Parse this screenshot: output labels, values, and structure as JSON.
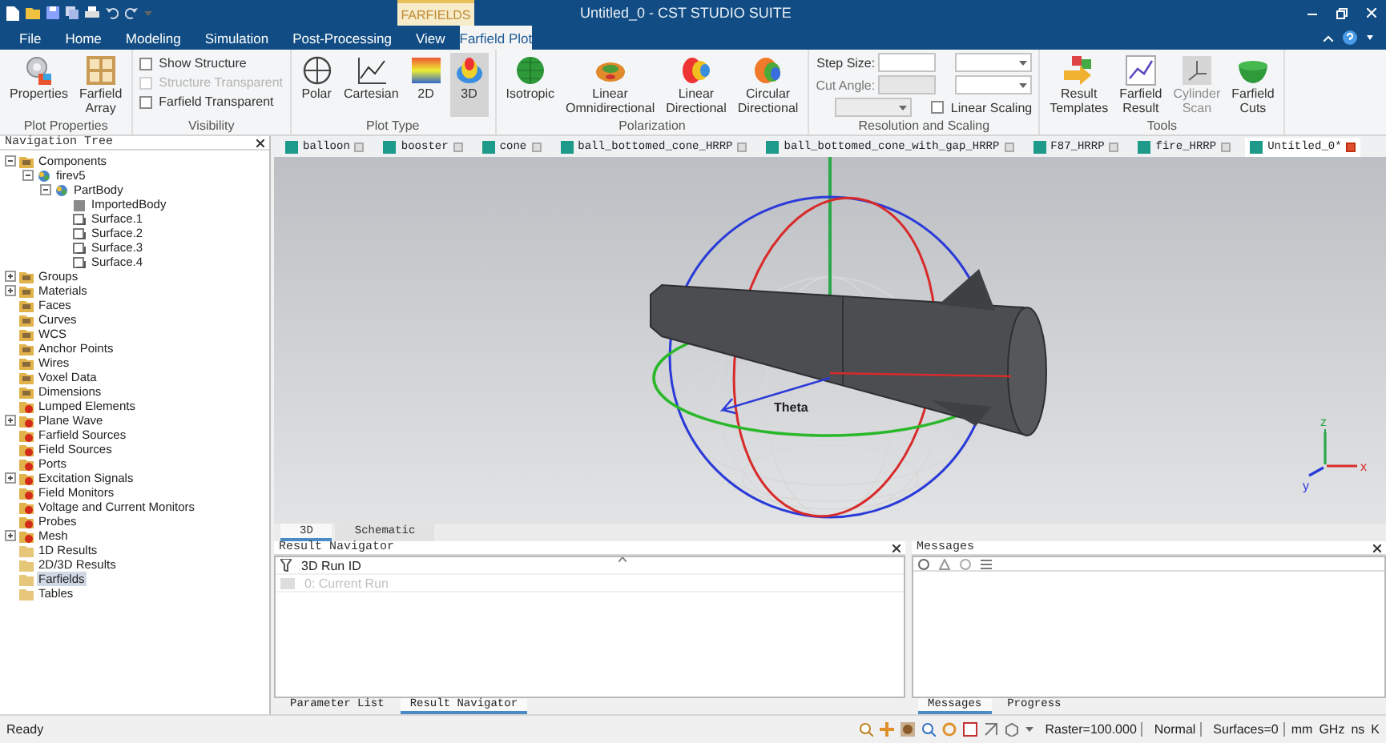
{
  "window": {
    "title": "Untitled_0 - CST STUDIO SUITE",
    "context_tab": "FARFIELDS"
  },
  "menu_tabs": [
    {
      "label": "File",
      "selected": false
    },
    {
      "label": "Home",
      "selected": false
    },
    {
      "label": "Modeling",
      "selected": false
    },
    {
      "label": "Simulation",
      "selected": false
    },
    {
      "label": "Post-Processing",
      "selected": false
    },
    {
      "label": "View",
      "selected": false
    },
    {
      "label": "Farfield Plot",
      "selected": true
    }
  ],
  "ribbon": {
    "groups": [
      {
        "title": "Plot Properties",
        "kind": "buttons",
        "items": [
          {
            "label": "Properties",
            "selected": false,
            "disabled": false
          },
          {
            "label": "Farfield\nArray",
            "selected": false,
            "disabled": false
          }
        ]
      },
      {
        "title": "Visibility",
        "kind": "checks",
        "items": [
          {
            "label": "Show Structure",
            "checked": false,
            "disabled": false
          },
          {
            "label": "Structure Transparent",
            "checked": false,
            "disabled": true
          },
          {
            "label": "Farfield Transparent",
            "checked": false,
            "disabled": false
          }
        ]
      },
      {
        "title": "Plot Type",
        "kind": "buttons",
        "items": [
          {
            "label": "Polar",
            "selected": false,
            "disabled": false
          },
          {
            "label": "Cartesian",
            "selected": false,
            "disabled": false
          },
          {
            "label": "2D",
            "selected": false,
            "disabled": false
          },
          {
            "label": "3D",
            "selected": true,
            "disabled": false
          }
        ]
      },
      {
        "title": "Polarization",
        "kind": "buttons",
        "items": [
          {
            "label": "Isotropic",
            "selected": false,
            "disabled": false
          },
          {
            "label": "Linear\nOmnidirectional",
            "selected": false,
            "disabled": false
          },
          {
            "label": "Linear\nDirectional",
            "selected": false,
            "disabled": false
          },
          {
            "label": "Circular\nDirectional",
            "selected": false,
            "disabled": false
          }
        ]
      },
      {
        "title": "Resolution and Scaling",
        "kind": "form",
        "rows": [
          [
            {
              "kind": "field",
              "label": "Step Size:",
              "disabled": false
            },
            {
              "kind": "dropdown",
              "disabled": false
            }
          ],
          [
            {
              "kind": "field",
              "label": "Cut Angle:",
              "disabled": true
            },
            {
              "kind": "dropdown",
              "disabled": false
            }
          ],
          [
            {
              "kind": "dropdown",
              "disabled": true
            },
            {
              "kind": "checkbox",
              "label": "Linear Scaling",
              "checked": false,
              "disabled": false
            }
          ]
        ]
      },
      {
        "title": "Tools",
        "kind": "buttons",
        "items": [
          {
            "label": "Result\nTemplates",
            "selected": false,
            "disabled": false
          },
          {
            "label": "Farfield\nResult",
            "selected": false,
            "disabled": false
          },
          {
            "label": "Cylinder\nScan",
            "selected": false,
            "disabled": true
          },
          {
            "label": "Farfield\nCuts",
            "selected": false,
            "disabled": false
          }
        ]
      }
    ]
  },
  "navigation_tree": {
    "title": "Navigation Tree",
    "items": [
      {
        "label": "Components",
        "kind": "folder",
        "selected": false,
        "expanded": true,
        "children": [
          {
            "label": "firev5",
            "kind": "component",
            "selected": false,
            "expanded": true,
            "children": [
              {
                "label": "PartBody",
                "kind": "component",
                "selected": false,
                "expanded": true,
                "children": [
                  {
                    "label": "ImportedBody",
                    "kind": "solid",
                    "selected": false
                  },
                  {
                    "label": "Surface.1",
                    "kind": "shape",
                    "selected": false
                  },
                  {
                    "label": "Surface.2",
                    "kind": "shape",
                    "selected": false
                  },
                  {
                    "label": "Surface.3",
                    "kind": "shape",
                    "selected": false
                  },
                  {
                    "label": "Surface.4",
                    "kind": "shape",
                    "selected": false
                  }
                ]
              }
            ]
          }
        ]
      },
      {
        "label": "Groups",
        "kind": "folder",
        "selected": false,
        "expanded": false
      },
      {
        "label": "Materials",
        "kind": "folder",
        "selected": false,
        "expanded": false
      },
      {
        "label": "Faces",
        "kind": "folder",
        "selected": false
      },
      {
        "label": "Curves",
        "kind": "folder",
        "selected": false
      },
      {
        "label": "WCS",
        "kind": "folder",
        "selected": false
      },
      {
        "label": "Anchor Points",
        "kind": "folder",
        "selected": false
      },
      {
        "label": "Wires",
        "kind": "folder",
        "selected": false
      },
      {
        "label": "Voxel Data",
        "kind": "folder",
        "selected": false
      },
      {
        "label": "Dimensions",
        "kind": "folder",
        "selected": false
      },
      {
        "label": "Lumped Elements",
        "kind": "alert",
        "selected": false
      },
      {
        "label": "Plane Wave",
        "kind": "alert",
        "selected": false,
        "expanded": false
      },
      {
        "label": "Farfield Sources",
        "kind": "alert",
        "selected": false
      },
      {
        "label": "Field Sources",
        "kind": "alert",
        "selected": false
      },
      {
        "label": "Ports",
        "kind": "alert",
        "selected": false
      },
      {
        "label": "Excitation Signals",
        "kind": "alert",
        "selected": false,
        "expanded": false
      },
      {
        "label": "Field Monitors",
        "kind": "alert",
        "selected": false
      },
      {
        "label": "Voltage and Current Monitors",
        "kind": "alert",
        "selected": false
      },
      {
        "label": "Probes",
        "kind": "alert",
        "selected": false
      },
      {
        "label": "Mesh",
        "kind": "alert",
        "selected": false,
        "expanded": false
      },
      {
        "label": "1D Results",
        "kind": "result",
        "selected": false
      },
      {
        "label": "2D/3D Results",
        "kind": "result",
        "selected": false
      },
      {
        "label": "Farfields",
        "kind": "result",
        "selected": true
      },
      {
        "label": "Tables",
        "kind": "result",
        "selected": false
      }
    ]
  },
  "document_tabs": [
    {
      "label": "balloon",
      "selected": false
    },
    {
      "label": "booster",
      "selected": false
    },
    {
      "label": "cone",
      "selected": false
    },
    {
      "label": "ball_bottomed_cone_HRRP",
      "selected": false
    },
    {
      "label": "ball_bottomed_cone_with_gap_HRRP",
      "selected": false
    },
    {
      "label": "F87_HRRP",
      "selected": false
    },
    {
      "label": "fire_HRRP",
      "selected": false
    },
    {
      "label": "Untitled_0*",
      "selected": true
    }
  ],
  "viewport": {
    "angle_label": "Theta",
    "axes": [
      "x",
      "y",
      "z"
    ]
  },
  "view_tabs": [
    {
      "label": "3D",
      "selected": true
    },
    {
      "label": "Schematic",
      "selected": false
    }
  ],
  "result_navigator": {
    "title": "Result Navigator",
    "header": "3D Run ID",
    "rows": [
      {
        "label": "0: Current Run",
        "disabled": true
      }
    ],
    "tabs": [
      {
        "label": "Parameter List",
        "selected": false
      },
      {
        "label": "Result Navigator",
        "selected": true
      }
    ]
  },
  "messages": {
    "title": "Messages",
    "tabs": [
      {
        "label": "Messages",
        "selected": true
      },
      {
        "label": "Progress",
        "selected": false
      }
    ]
  },
  "status_bar": {
    "message": "Ready",
    "fields": [
      "Raster=100.000",
      "Normal",
      "Surfaces=0"
    ],
    "units": [
      "mm",
      "GHz",
      "ns",
      "K"
    ]
  }
}
